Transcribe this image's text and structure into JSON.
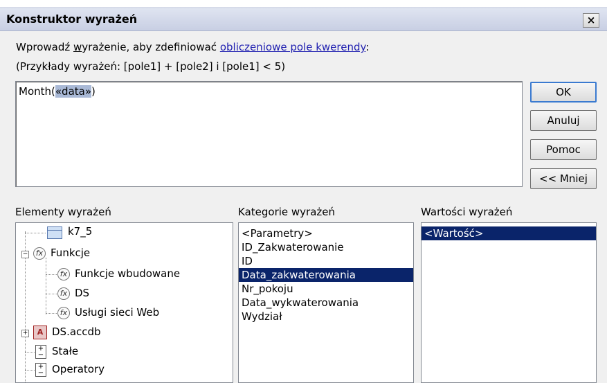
{
  "window": {
    "title": "Konstruktor wyrażeń",
    "close_glyph": "×"
  },
  "instructions": {
    "line1_prefix": "Wprowadź ",
    "line1_underlined": "w",
    "line1_mid": "yrażenie, aby zdefiniować ",
    "line1_link": "obliczeniowe pole kwerendy",
    "line1_suffix": ":",
    "line2": "(Przykłady wyrażeń: [pole1] + [pole2] i [pole1] < 5)"
  },
  "expression": {
    "prefix": "Month(",
    "selected": "«data»",
    "suffix": ")"
  },
  "buttons": {
    "ok": "OK",
    "cancel": "Anuluj",
    "help": "Pomoc",
    "less": "<< Mniej"
  },
  "elements": {
    "label": "Elementy wyrażeń",
    "tree": [
      {
        "label": "k7_5",
        "icon": "table-icon"
      },
      {
        "label": "Funkcje",
        "icon": "function-icon"
      },
      {
        "label": "Funkcje wbudowane",
        "icon": "function-icon"
      },
      {
        "label": "DS",
        "icon": "function-icon"
      },
      {
        "label": "Usługi sieci Web",
        "icon": "function-icon"
      },
      {
        "label": "DS.accdb",
        "icon": "access-db-icon"
      },
      {
        "label": "Stałe",
        "icon": "constants-icon"
      },
      {
        "label": "Operatory",
        "icon": "operators-icon"
      }
    ]
  },
  "categories": {
    "label": "Kategorie wyrażeń",
    "items": [
      "<Parametry>",
      "ID_Zakwaterowanie",
      "ID",
      "Data_zakwaterowania",
      "Nr_pokoju",
      "Data_wykwaterowania",
      "Wydział"
    ],
    "selected_index": 3
  },
  "values": {
    "label": "Wartości wyrażeń",
    "items": [
      "<Wartość>"
    ],
    "selected_index": 0
  },
  "colors": {
    "selection": "#0a246a",
    "link": "#1f1fb0",
    "ok_border": "#3a7ad0"
  }
}
